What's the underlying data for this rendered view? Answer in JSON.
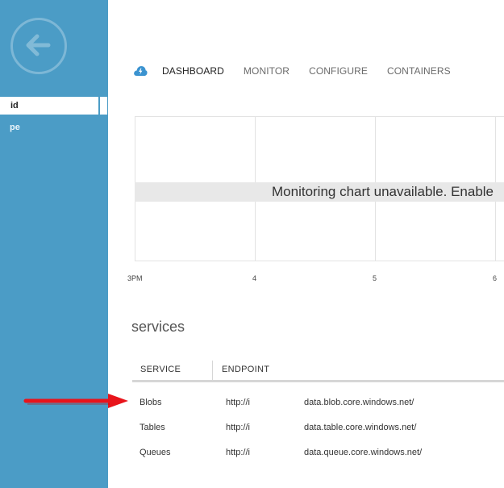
{
  "sidebar": {
    "items": [
      {
        "label": "id"
      },
      {
        "label": "pe"
      }
    ]
  },
  "tabs": [
    {
      "label": "DASHBOARD",
      "active": true
    },
    {
      "label": "MONITOR"
    },
    {
      "label": "CONFIGURE"
    },
    {
      "label": "CONTAINERS"
    }
  ],
  "chart": {
    "message": "Monitoring chart unavailable. Enable",
    "ticks": [
      "3PM",
      "4",
      "5",
      "6"
    ]
  },
  "services": {
    "title": "services",
    "headers": {
      "service": "SERVICE",
      "endpoint": "ENDPOINT"
    },
    "rows": [
      {
        "service": "Blobs",
        "endpoint_prefix": "http://i",
        "endpoint_suffix": "data.blob.core.windows.net/"
      },
      {
        "service": "Tables",
        "endpoint_prefix": "http://i",
        "endpoint_suffix": "data.table.core.windows.net/"
      },
      {
        "service": "Queues",
        "endpoint_prefix": "http://i",
        "endpoint_suffix": "data.queue.core.windows.net/"
      }
    ]
  },
  "colors": {
    "sidebar": "#4b9cc6",
    "accent": "#3b93d0",
    "arrow": "#e8141b"
  },
  "icons": {
    "back": "back-arrow-icon",
    "service": "storage-cloud-icon",
    "pointer": "red-arrow-icon"
  }
}
